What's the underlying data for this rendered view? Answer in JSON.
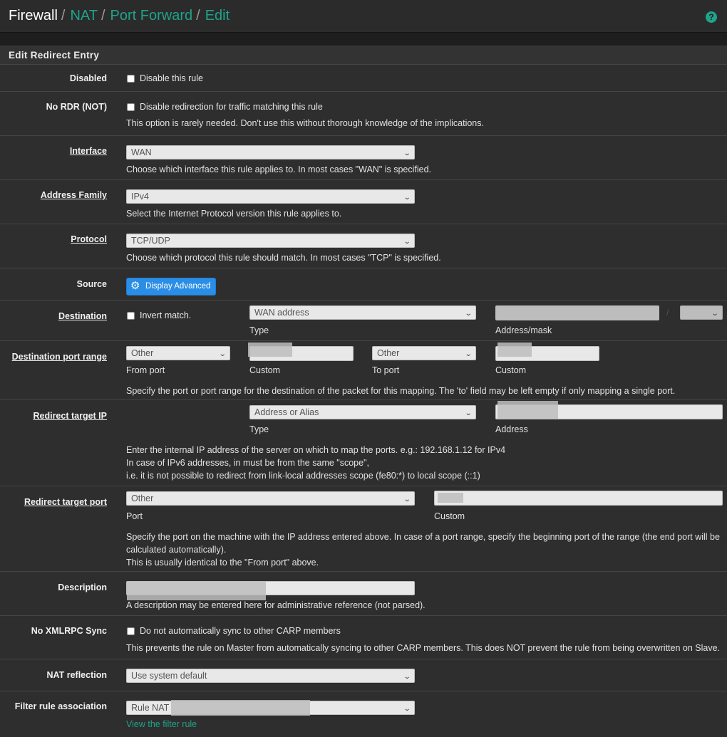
{
  "breadcrumb": {
    "firewall": "Firewall",
    "nat": "NAT",
    "port_forward": "Port Forward",
    "edit": "Edit",
    "sep": "/"
  },
  "help_icon": "?",
  "panel": {
    "title": "Edit Redirect Entry"
  },
  "rows": {
    "disabled": {
      "label": "Disabled",
      "checkbox_label": "Disable this rule"
    },
    "nordr": {
      "label": "No RDR (NOT)",
      "checkbox_label": "Disable redirection for traffic matching this rule",
      "help": "This option is rarely needed. Don't use this without thorough knowledge of the implications."
    },
    "interface": {
      "label": "Interface",
      "value": "WAN",
      "help": "Choose which interface this rule applies to. In most cases \"WAN\" is specified."
    },
    "address_family": {
      "label": "Address Family",
      "value": "IPv4",
      "help": "Select the Internet Protocol version this rule applies to."
    },
    "protocol": {
      "label": "Protocol",
      "value": "TCP/UDP",
      "help": "Choose which protocol this rule should match. In most cases \"TCP\" is specified."
    },
    "source": {
      "label": "Source",
      "button": "Display Advanced"
    },
    "destination": {
      "label": "Destination",
      "invert_label": "Invert match.",
      "type_value": "WAN address",
      "type_caption": "Type",
      "mask_sep": "/",
      "address_caption": "Address/mask"
    },
    "dest_port_range": {
      "label": "Destination port range",
      "from_value": "Other",
      "from_caption": "From port",
      "custom_caption": "Custom",
      "to_value": "Other",
      "to_caption": "To port",
      "custom2_caption": "Custom",
      "help": "Specify the port or port range for the destination of the packet for this mapping. The 'to' field may be left empty if only mapping a single port."
    },
    "redirect_ip": {
      "label": "Redirect target IP",
      "type_value": "Address or Alias",
      "type_caption": "Type",
      "address_caption": "Address",
      "help1": "Enter the internal IP address of the server on which to map the ports. e.g.: 192.168.1.12 for IPv4",
      "help2": "In case of IPv6 addresses, in must be from the same \"scope\",",
      "help3": "i.e. it is not possible to redirect from link-local addresses scope (fe80:*) to local scope (::1)"
    },
    "redirect_port": {
      "label": "Redirect target port",
      "port_value": "Other",
      "port_caption": "Port",
      "custom_caption": "Custom",
      "help1": "Specify the port on the machine with the IP address entered above. In case of a port range, specify the beginning port of the range (the end port will be",
      "help2": "calculated automatically).",
      "help3": "This is usually identical to the \"From port\" above."
    },
    "description": {
      "label": "Description",
      "help": "A description may be entered here for administrative reference (not parsed)."
    },
    "xmlrpc": {
      "label": "No XMLRPC Sync",
      "checkbox_label": "Do not automatically sync to other CARP members",
      "help": "This prevents the rule on Master from automatically syncing to other CARP members. This does NOT prevent the rule from being overwritten on Slave."
    },
    "nat_reflection": {
      "label": "NAT reflection",
      "value": "Use system default"
    },
    "filter_assoc": {
      "label": "Filter rule association",
      "value": "Rule NAT",
      "link": "View the filter rule"
    }
  },
  "icons": {
    "chevron": "chevron-down-icon",
    "gear": "gear-icon",
    "help": "question-circle-icon"
  }
}
